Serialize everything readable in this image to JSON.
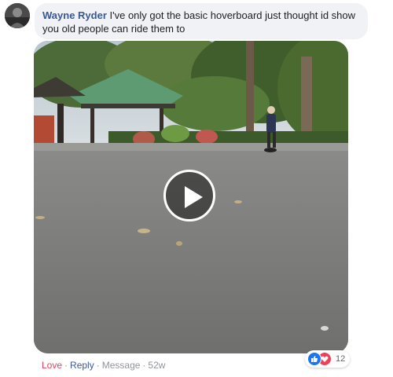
{
  "comment": {
    "author": "Wayne Ryder",
    "text": "I've only got the basic hoverboard just thought id show you old people can ride them to",
    "avatar_icon": "user-avatar-photo"
  },
  "video": {
    "play_icon": "play-icon"
  },
  "actions": {
    "love_label": "Love",
    "separator": "·",
    "reply_label": "Reply",
    "message_label": "Message",
    "time_label": "52w"
  },
  "reactions": {
    "icons": [
      "like-icon",
      "love-icon"
    ],
    "count": "12"
  },
  "colors": {
    "author_link": "#385898",
    "love_red": "#e4405f",
    "like_blue": "#1877f2",
    "bubble_bg": "#f0f2f5"
  }
}
